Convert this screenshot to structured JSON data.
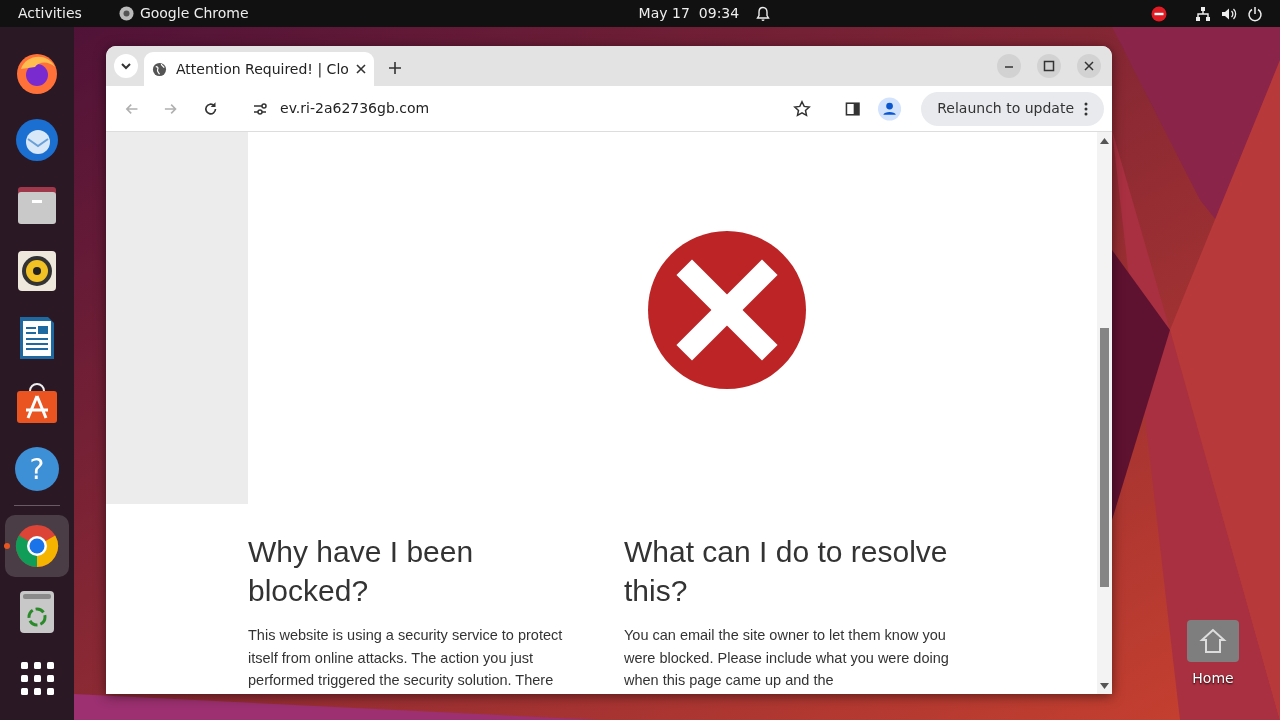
{
  "top_bar": {
    "activities": "Activities",
    "app_name": "Google Chrome",
    "date": "May 17",
    "time": "09:34"
  },
  "dock": {
    "items": [
      {
        "kind": "firefox",
        "running": false
      },
      {
        "kind": "thunderbird",
        "running": false
      },
      {
        "kind": "files",
        "running": false
      },
      {
        "kind": "rhythmbox",
        "running": false
      },
      {
        "kind": "writer",
        "running": false
      },
      {
        "kind": "appcenter",
        "running": false
      },
      {
        "kind": "help",
        "glyph": "?",
        "running": false
      },
      {
        "kind": "separator",
        "running": false
      },
      {
        "kind": "chrome",
        "running": true
      },
      {
        "kind": "trash",
        "running": false
      },
      {
        "kind": "apps",
        "running": false
      }
    ]
  },
  "browser": {
    "tabs": [
      {
        "title": "Attention Required! | Clo",
        "selected": true
      }
    ],
    "nav_buttons": [
      {
        "kind": "back",
        "disabled": true
      },
      {
        "kind": "forward",
        "disabled": true
      },
      {
        "kind": "reload",
        "disabled": false
      }
    ],
    "address": "ev.ri-2a62736gb.com",
    "relaunch_button": "Relaunch to update"
  },
  "page": {
    "sections": [
      {
        "heading": "Why have I been blocked?",
        "text": "This website is using a security service to protect itself from online attacks. The action you just performed triggered the security solution. There"
      },
      {
        "heading": "What can I do to resolve this?",
        "text": "You can email the site owner to let them know you were blocked. Please include what you were doing when this page came up and the"
      }
    ]
  },
  "desktop_icons": [
    {
      "label": "Home"
    }
  ]
}
